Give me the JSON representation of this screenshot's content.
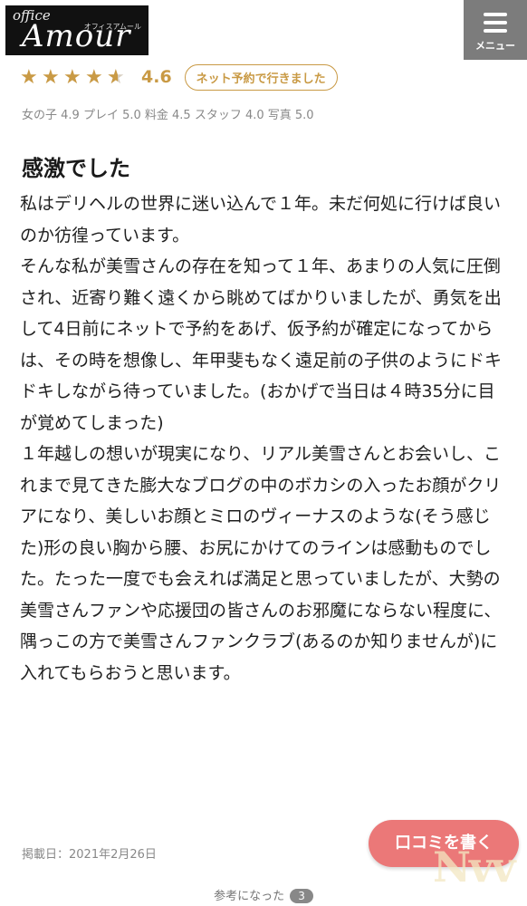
{
  "header": {
    "logo_office": "office",
    "logo_amour": "Amour",
    "logo_kana": "オフィスアムール",
    "menu_label": "メニュー"
  },
  "rating": {
    "stars": 4.5,
    "score": "4.6",
    "badge": "ネット予約で行きました",
    "star_color": "#c99a45"
  },
  "sub_scores": "女の子 4.9 プレイ 5.0 料金 4.5 スタッフ 4.0 写真 5.0",
  "review": {
    "title": "感激でした",
    "body": "私はデリヘルの世界に迷い込んで１年。未だ何処に行けば良いのか彷徨っています。\nそんな私が美雪さんの存在を知って１年、あまりの人気に圧倒され、近寄り難く遠くから眺めてばかりいましたが、勇気を出して4日前にネットで予約をあげ、仮予約が確定になってからは、その時を想像し、年甲斐もなく遠足前の子供のようにドキドキしながら待っていました。(おかげで当日は４時35分に目が覚めてしまった)\n１年越しの想いが現実になり、リアル美雪さんとお会いし、これまで見てきた膨大なブログの中のボカシの入ったお顔がクリアになり、美しいお顔とミロのヴィーナスのような(そう感じた)形の良い胸から腰、お尻にかけてのラインは感動ものでした。たった一度でも会えれば満足と思っていましたが、大勢の美雪さんファンや応援団の皆さんのお邪魔にならない程度に、隅っこの方で美雪さんファンクラブ(あるのか知りませんが)に入れてもらおうと思います。",
    "posted": "掲載日：2021年2月26日"
  },
  "cta_label": "口コミを書く",
  "watermark_text": "Nvv",
  "helpful": {
    "label": "参考になった",
    "count": "3"
  }
}
